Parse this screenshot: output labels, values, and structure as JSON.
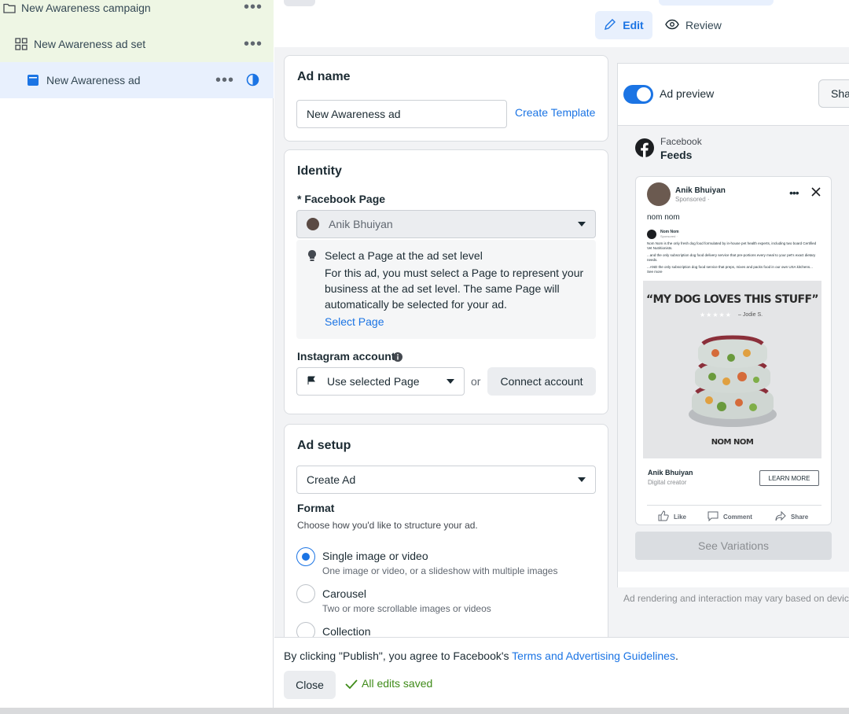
{
  "tree": {
    "campaign": "New Awareness campaign",
    "adset": "New Awareness ad set",
    "ad": "New Awareness ad"
  },
  "mode": {
    "edit": "Edit",
    "review": "Review"
  },
  "ad_name": {
    "heading": "Ad name",
    "value": "New Awareness ad",
    "template_link": "Create Template"
  },
  "identity": {
    "heading": "Identity",
    "page_label": "* Facebook Page",
    "page_value": "Anik Bhuiyan",
    "info_title": "Select a Page at the ad set level",
    "info_body": "For this ad, you must select a Page to represent your business at the ad set level. The same Page will automatically be selected for your ad.",
    "info_link": "Select Page",
    "instagram_label": "Instagram account",
    "instagram_value": "Use selected Page",
    "or": "or",
    "connect_button": "Connect account"
  },
  "ad_setup": {
    "heading": "Ad setup",
    "creation_value": "Create Ad",
    "format_label": "Format",
    "format_help": "Choose how you'd like to structure your ad.",
    "options": [
      {
        "label": "Single image or video",
        "desc": "One image or video, or a slideshow with multiple images",
        "selected": true
      },
      {
        "label": "Carousel",
        "desc": "Two or more scrollable images or videos",
        "selected": false
      },
      {
        "label": "Collection",
        "desc": "",
        "selected": false
      }
    ]
  },
  "preview": {
    "toggle_label": "Ad preview",
    "share_button": "Sha",
    "platform": "Facebook",
    "placement": "Feeds",
    "post_author": "Anik Bhuiyan",
    "post_meta": "Sponsored · ",
    "post_text": "nom nom",
    "inner_brand": "Nom Nom",
    "inner_meta": "Sponsored · ",
    "inner_text_1": "Nom Nom is the only fresh dog food formulated by in-house pet health experts, including two board Certified Vet Nutritionists.",
    "inner_text_2": "...and the only subscription dog food delivery service that pre-portions every meal to your pet's exact dietary needs.",
    "inner_text_3": "...AND the only subscription dog food service that preps, mixes and packs food in our own USA kitchens... See more",
    "quote": "“MY DOG LOVES THIS STUFF”",
    "stars": "★★★★★",
    "reviewer": "– Jodie S.",
    "brand_mark": "NOM NOM",
    "cta_name": "Anik Bhuiyan",
    "cta_sub": "Digital creator",
    "cta_button": "LEARN MORE",
    "like": "Like",
    "comment": "Comment",
    "share": "Share",
    "variations_button": "See Variations",
    "disclaimer": "Ad rendering and interaction may vary based on device"
  },
  "footer": {
    "agree_text": "By clicking \"Publish\", you agree to Facebook's ",
    "terms_link": "Terms and Advertising Guidelines",
    "period": ".",
    "close_button": "Close",
    "saved_status": "All edits saved"
  },
  "colors": {
    "accent": "#1b74e4",
    "campaign_bg": "#eef6e4",
    "selected_bg": "#e8f0fd",
    "saved_green": "#3f8b19"
  }
}
